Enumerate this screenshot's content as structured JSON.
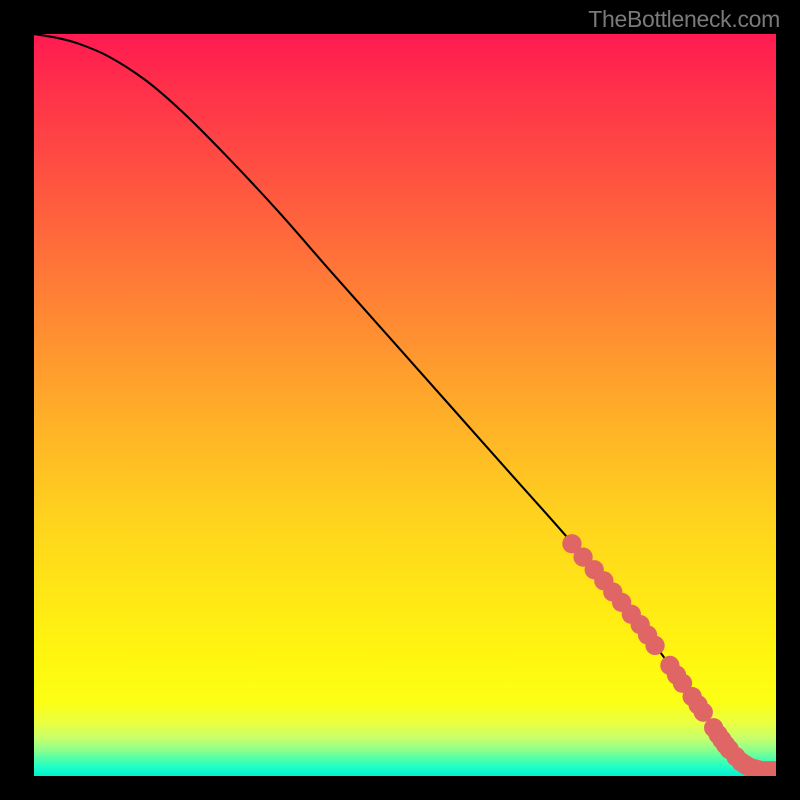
{
  "attribution": "TheBottleneck.com",
  "chart_data": {
    "type": "line",
    "title": "",
    "xlabel": "",
    "ylabel": "",
    "xlim": [
      0,
      100
    ],
    "ylim": [
      0,
      100
    ],
    "series": [
      {
        "name": "curve",
        "x": [
          0,
          3,
          6,
          10,
          15,
          20,
          26,
          33,
          40,
          48,
          56,
          64,
          72,
          80,
          86,
          90,
          92,
          94,
          96,
          98,
          100
        ],
        "y": [
          100,
          99.5,
          98.7,
          97.0,
          93.8,
          89.5,
          83.5,
          76.0,
          68.0,
          59.0,
          50.0,
          41.0,
          32.0,
          22.5,
          14.5,
          9.0,
          5.8,
          3.2,
          1.6,
          0.7,
          0.45
        ]
      }
    ],
    "markers": {
      "name": "highlighted-points",
      "color": "#e06666",
      "items": [
        {
          "x": 72.5,
          "y": 31.3,
          "r": 1.3
        },
        {
          "x": 74.0,
          "y": 29.5,
          "r": 1.3
        },
        {
          "x": 75.5,
          "y": 27.8,
          "r": 1.3
        },
        {
          "x": 76.8,
          "y": 26.3,
          "r": 1.3
        },
        {
          "x": 78.0,
          "y": 24.8,
          "r": 1.3
        },
        {
          "x": 79.2,
          "y": 23.4,
          "r": 1.3
        },
        {
          "x": 80.5,
          "y": 21.8,
          "r": 1.3
        },
        {
          "x": 81.7,
          "y": 20.4,
          "r": 1.3
        },
        {
          "x": 82.7,
          "y": 19.0,
          "r": 1.3
        },
        {
          "x": 83.7,
          "y": 17.6,
          "r": 1.3
        },
        {
          "x": 85.7,
          "y": 14.9,
          "r": 1.3
        },
        {
          "x": 86.6,
          "y": 13.6,
          "r": 1.3
        },
        {
          "x": 87.4,
          "y": 12.5,
          "r": 1.3
        },
        {
          "x": 88.7,
          "y": 10.7,
          "r": 1.3
        },
        {
          "x": 89.5,
          "y": 9.6,
          "r": 1.3
        },
        {
          "x": 90.2,
          "y": 8.6,
          "r": 1.3
        },
        {
          "x": 91.6,
          "y": 6.5,
          "r": 1.3
        },
        {
          "x": 92.2,
          "y": 5.6,
          "r": 1.3
        },
        {
          "x": 92.7,
          "y": 4.9,
          "r": 1.3
        },
        {
          "x": 93.2,
          "y": 4.2,
          "r": 1.3
        },
        {
          "x": 93.7,
          "y": 3.6,
          "r": 1.3
        },
        {
          "x": 94.6,
          "y": 2.6,
          "r": 1.3
        },
        {
          "x": 95.3,
          "y": 1.9,
          "r": 1.3
        },
        {
          "x": 95.9,
          "y": 1.5,
          "r": 1.3
        },
        {
          "x": 96.4,
          "y": 1.2,
          "r": 1.3
        },
        {
          "x": 96.9,
          "y": 1.0,
          "r": 1.3
        },
        {
          "x": 97.3,
          "y": 0.9,
          "r": 1.3
        },
        {
          "x": 97.7,
          "y": 0.8,
          "r": 1.3
        },
        {
          "x": 98.1,
          "y": 0.7,
          "r": 1.3
        },
        {
          "x": 98.5,
          "y": 0.7,
          "r": 1.3
        },
        {
          "x": 98.9,
          "y": 0.7,
          "r": 1.3
        },
        {
          "x": 99.2,
          "y": 0.7,
          "r": 1.3
        },
        {
          "x": 99.5,
          "y": 0.7,
          "r": 1.3
        },
        {
          "x": 100.0,
          "y": 0.7,
          "r": 1.3
        },
        {
          "x": 101.2,
          "y": 0.7,
          "r": 1.3
        },
        {
          "x": 102.7,
          "y": 0.7,
          "r": 1.3
        },
        {
          "x": 103.5,
          "y": 0.7,
          "r": 1.3
        }
      ]
    },
    "gradient_stops": [
      {
        "pos": 0,
        "color": "#ff1a52"
      },
      {
        "pos": 0.07,
        "color": "#ff2f4a"
      },
      {
        "pos": 0.22,
        "color": "#ff5a3f"
      },
      {
        "pos": 0.38,
        "color": "#ff8833"
      },
      {
        "pos": 0.52,
        "color": "#ffb028"
      },
      {
        "pos": 0.65,
        "color": "#ffd21e"
      },
      {
        "pos": 0.75,
        "color": "#ffe616"
      },
      {
        "pos": 0.84,
        "color": "#fff60f"
      },
      {
        "pos": 0.9,
        "color": "#fcff15"
      },
      {
        "pos": 0.93,
        "color": "#e8ff44"
      },
      {
        "pos": 0.95,
        "color": "#c4ff6e"
      },
      {
        "pos": 0.965,
        "color": "#8cff8c"
      },
      {
        "pos": 0.978,
        "color": "#4affac"
      },
      {
        "pos": 0.988,
        "color": "#1effc8"
      },
      {
        "pos": 1.0,
        "color": "#00f0d2"
      }
    ]
  }
}
